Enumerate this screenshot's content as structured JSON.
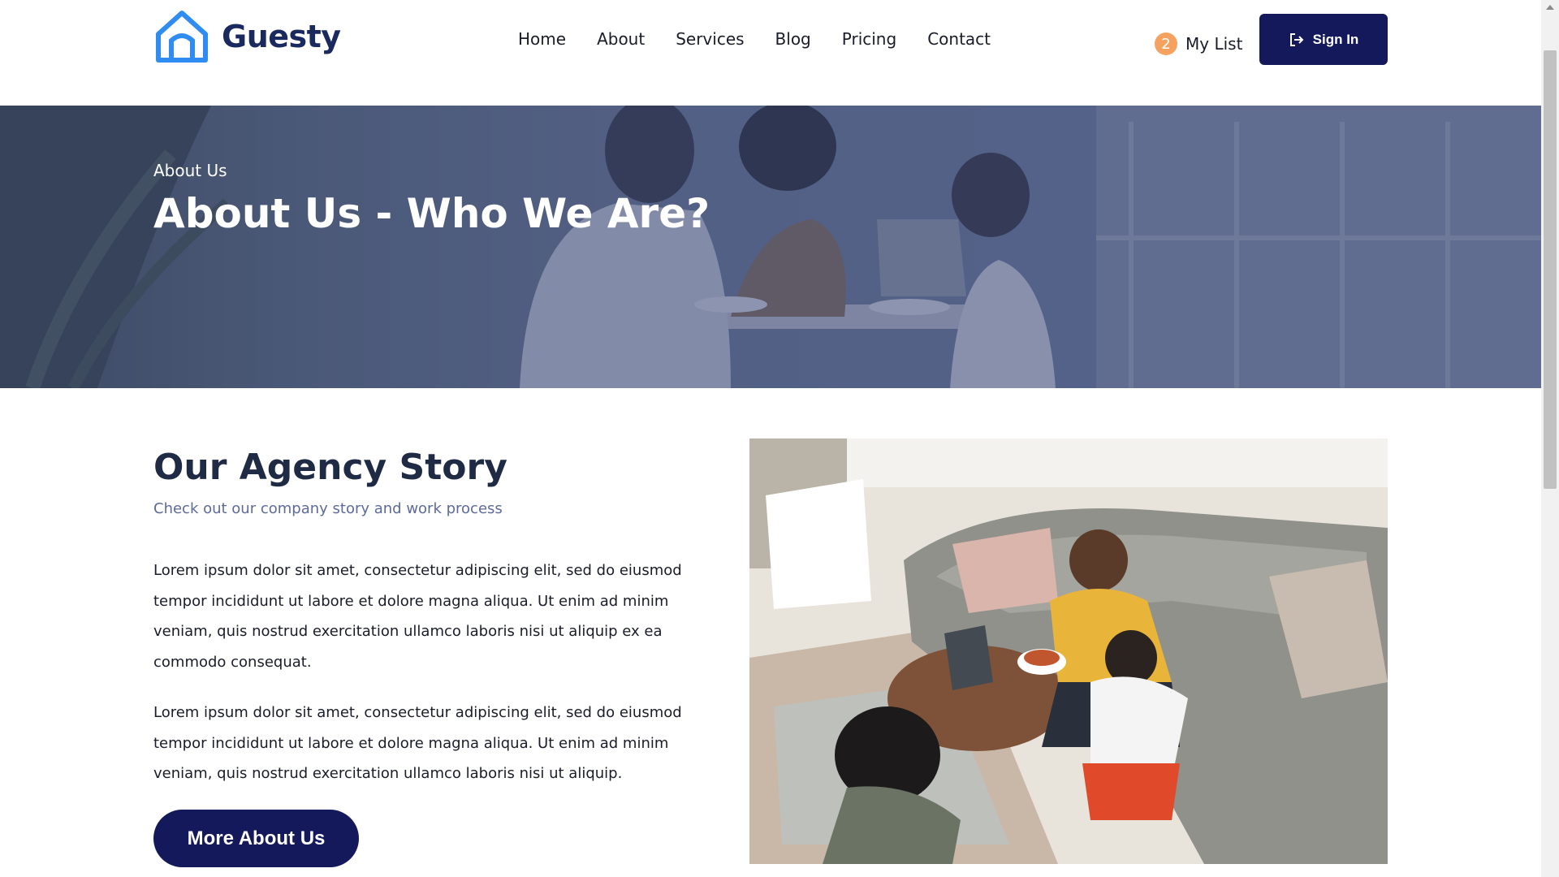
{
  "brand": {
    "name": "Guesty",
    "accent": "#2f8cf0",
    "primary": "#13195a"
  },
  "nav": {
    "items": [
      {
        "label": "Home"
      },
      {
        "label": "About"
      },
      {
        "label": "Services"
      },
      {
        "label": "Blog"
      },
      {
        "label": "Pricing"
      },
      {
        "label": "Contact"
      }
    ]
  },
  "header": {
    "mylist_count": "2",
    "mylist_label": "My List",
    "signin_label": "Sign In",
    "signin_icon": "sign-in-icon"
  },
  "hero": {
    "subtitle": "About Us",
    "title": "About Us - Who We Are?"
  },
  "story": {
    "title": "Our Agency Story",
    "subtitle": "Check out our company story and work process",
    "paragraph1": "Lorem ipsum dolor sit amet, consectetur adipiscing elit, sed do eiusmod tempor incididunt ut labore et dolore magna aliqua. Ut enim ad minim veniam, quis nostrud exercitation ullamco laboris nisi ut aliquip ex ea commodo consequat.",
    "paragraph2": "Lorem ipsum dolor sit amet, consectetur adipiscing elit, sed do eiusmod tempor incididunt ut labore et dolore magna aliqua. Ut enim ad minim veniam, quis nostrud exercitation ullamco laboris nisi ut aliquip.",
    "button_label": "More About Us"
  }
}
